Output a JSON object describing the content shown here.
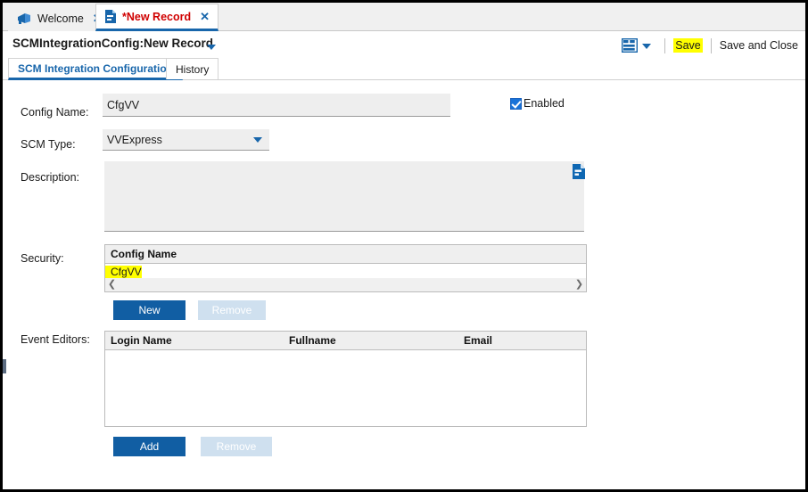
{
  "window": {
    "tabs": [
      {
        "label": "Welcome",
        "icon": "megaphone-icon",
        "close": "✕",
        "active": false
      },
      {
        "label": "*New Record",
        "icon": "document-icon",
        "close": "✕",
        "active": true
      }
    ]
  },
  "header": {
    "record_title": "SCMIntegrationConfig:New Record",
    "caret_icon": "chevron-down-icon",
    "toolbar": {
      "layout_icon": "grid-layout-icon",
      "layout_caret_icon": "chevron-down-icon",
      "save_label": "Save",
      "save_and_close_label": "Save and Close",
      "save_highlight_color": "#ffff00"
    }
  },
  "subtabs": [
    {
      "label": "SCM Integration Configuration",
      "active": true
    },
    {
      "label": "History",
      "active": false
    }
  ],
  "form": {
    "config_name": {
      "label": "Config Name:",
      "value": "CfgVV",
      "placeholder": ""
    },
    "enabled": {
      "label": "Enabled",
      "checked": true
    },
    "scm_type": {
      "label": "SCM Type:",
      "value": "VVExpress",
      "options": [
        "VVExpress"
      ],
      "caret_icon": "chevron-down-icon"
    },
    "description": {
      "label": "Description:",
      "value": "",
      "placeholder": "",
      "note_icon": "document-note-icon"
    },
    "security": {
      "label": "Security:",
      "columns": [
        "Config Name"
      ],
      "rows": [
        {
          "config_name": "CfgVV",
          "highlighted": true
        }
      ],
      "scroll_left_icon": "chevron-left-icon",
      "scroll_right_icon": "chevron-right-icon",
      "buttons": [
        {
          "label": "New",
          "enabled": true
        },
        {
          "label": "Remove",
          "enabled": false
        }
      ]
    },
    "event_editors": {
      "label": "Event Editors:",
      "columns": [
        "Login Name",
        "Fullname",
        "Email"
      ],
      "rows": [],
      "buttons": [
        {
          "label": "Add",
          "enabled": true
        },
        {
          "label": "Remove",
          "enabled": false
        }
      ]
    }
  },
  "colors": {
    "accent_blue": "#1866ab",
    "button_blue": "#115ea3",
    "highlight_yellow": "#ffff00",
    "tab_red": "#d00000"
  }
}
